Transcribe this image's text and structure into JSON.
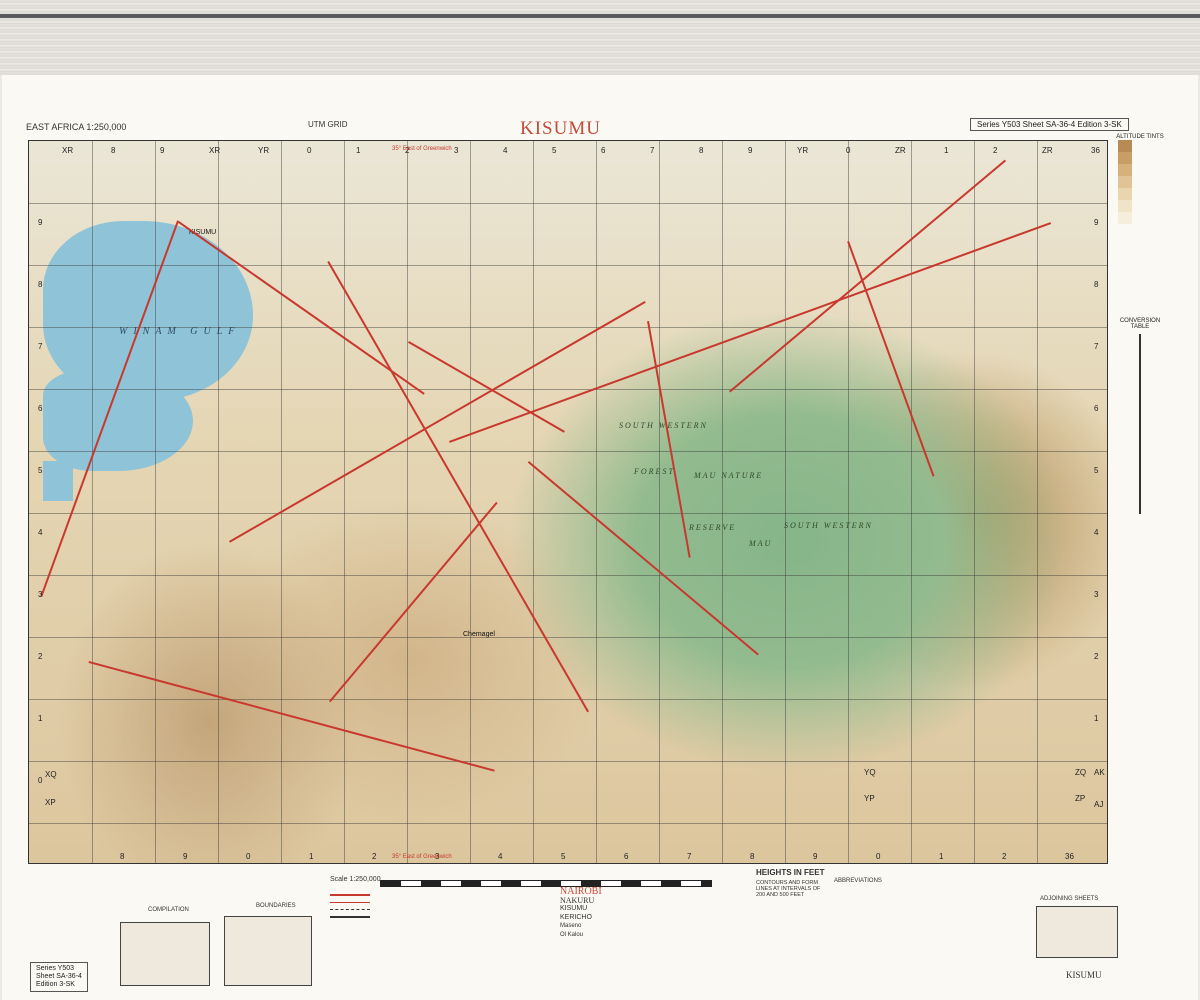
{
  "header": {
    "left": "EAST AFRICA 1:250,000",
    "grid": "UTM GRID",
    "title": "KISUMU",
    "series": "Series Y503  Sheet  SA-36-4  Edition 3-SK"
  },
  "map": {
    "lake_label": "WINAM GULF",
    "towns": [
      "KISUMU",
      "Chemagel"
    ],
    "forest_labels": [
      "SOUTH WESTERN",
      "MAU NATURE",
      "RESERVE",
      "FOREST",
      "SOUTH WESTERN",
      "MAU"
    ],
    "grid_top": [
      "XR",
      "8",
      "9",
      "XR",
      "YR",
      "0",
      "1",
      "2",
      "3",
      "4",
      "5",
      "6",
      "7",
      "8",
      "9",
      "YR",
      "0",
      "ZR",
      "1",
      "2",
      "ZR",
      "36"
    ],
    "grid_bottom": [
      "8",
      "9",
      "0",
      "1",
      "2",
      "3",
      "4",
      "5",
      "6",
      "7",
      "8",
      "9",
      "0",
      "1",
      "2",
      "36"
    ],
    "grid_left": [
      "9",
      "8",
      "7",
      "6",
      "5",
      "4",
      "3",
      "2",
      "1",
      "0"
    ],
    "grid_right": [
      "9",
      "8",
      "7",
      "6",
      "5",
      "4",
      "3",
      "2",
      "1"
    ],
    "corner_codes": [
      "XQ",
      "YQ",
      "ZQ",
      "AK",
      "XP",
      "YP",
      "ZP",
      "AJ"
    ],
    "meridian_top": "35° East of Greenwich",
    "meridian_bottom": "35° East of Greenwich"
  },
  "side": {
    "altitude": "ALTITUDE TINTS",
    "conversion": "CONVERSION TABLE",
    "tint_colors": [
      "#b88a55",
      "#c99d66",
      "#d6b17c",
      "#e1c495",
      "#ead5ad",
      "#f1e3c6",
      "#f6eedb"
    ]
  },
  "bottom": {
    "scale_label": "Scale 1:250,000",
    "heights_title": "HEIGHTS IN FEET",
    "heights_sub": "CONTOURS AND FORM LINES AT INTERVALS OF 200 AND 500 FEET",
    "town_samples": [
      "NAIROBI",
      "NAKURU",
      "KISUMU",
      "KERICHO",
      "Maseno",
      "Ol Kalou"
    ],
    "abbreviations": "ABBREVIATIONS",
    "compilation": "COMPILATION",
    "boundaries": "BOUNDARIES",
    "adjoining": "ADJOINING SHEETS",
    "corner_title": "KISUMU",
    "corner_series": [
      "Series  Y503",
      "Sheet  SA-36-4",
      "Edition  3-SK"
    ]
  }
}
